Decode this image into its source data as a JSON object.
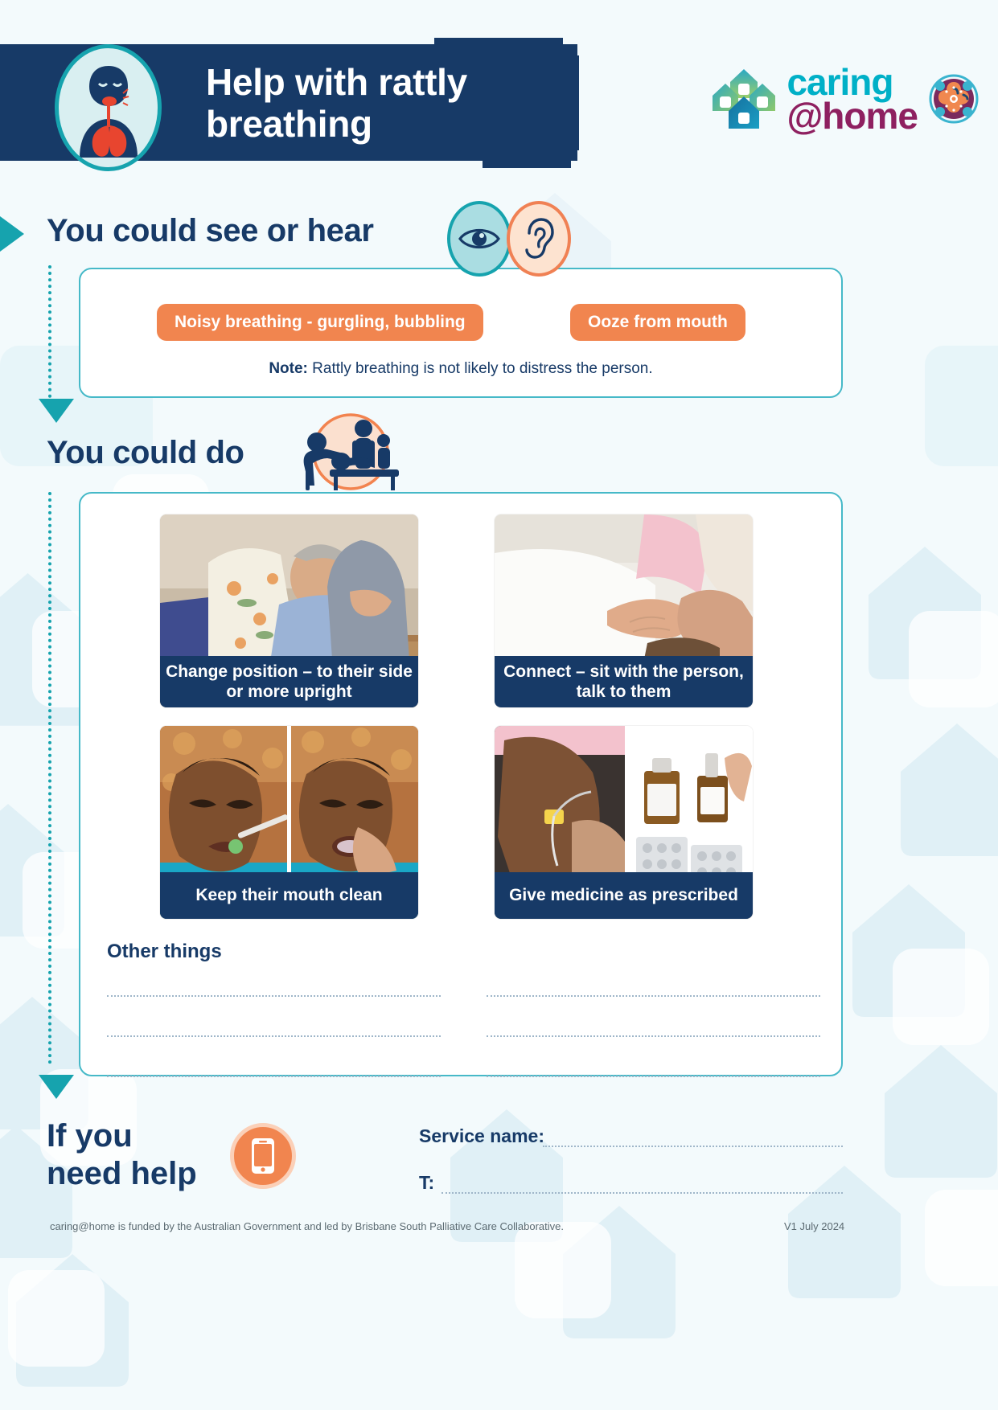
{
  "header": {
    "title_line1": "Help with rattly",
    "title_line2": "breathing",
    "icon_name": "person-rattly-breathing-lungs-icon",
    "logo": {
      "caring": "caring",
      "home": "@home",
      "mark_name": "caring-at-home-houses-logo",
      "emblem_name": "aboriginal-art-emblem"
    }
  },
  "see_or_hear": {
    "heading": "You could see or hear",
    "eye_icon": "eye-icon",
    "ear_icon": "ear-icon",
    "pills": [
      "Noisy breathing -  gurgling, bubbling",
      "Ooze from mouth"
    ],
    "note_label": "Note:",
    "note_text": " Rattly breathing is not likely to distress the person."
  },
  "could_do": {
    "heading": "You could do",
    "icon_name": "carers-with-person-in-bed-icon",
    "cards": [
      {
        "caption": "Change position – to their side or more upright",
        "photo_name": "man-lying-in-bed-being-repositioned-photo"
      },
      {
        "caption": "Connect – sit with the person, talk to them",
        "photo_name": "hands-held-on-bed-photo"
      },
      {
        "caption": "Keep their mouth clean",
        "photo_name": "mouth-care-swab-photo"
      },
      {
        "caption": "Give medicine as prescribed",
        "photo_name": "subcutaneous-line-and-medicines-photo"
      }
    ],
    "other_things_label": "Other things",
    "write_lines": 3
  },
  "need_help": {
    "heading_line1": "If you",
    "heading_line2": "need help",
    "phone_icon": "mobile-phone-icon",
    "service_label": "Service name:",
    "phone_label": "T:"
  },
  "footer": {
    "funding": "caring@home is funded by the Australian Government and led by Brisbane South Palliative Care Collaborative.",
    "version": "V1 July 2024"
  },
  "colors": {
    "navy": "#173a67",
    "teal": "#16a3ae",
    "orange": "#f1854f",
    "logo_teal": "#00b0c7",
    "logo_magenta": "#8e2060",
    "page_bg": "#f2f9fc"
  }
}
